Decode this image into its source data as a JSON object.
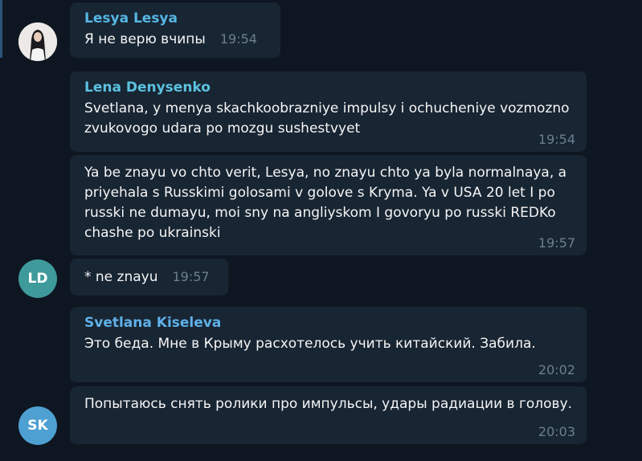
{
  "colors": {
    "background": "#0e1621",
    "bubble": "#182533",
    "name_lesya": "#56b7e4",
    "name_lena": "#5bc2e0",
    "name_svetlana": "#5fb1e8",
    "avatar_ld": "#3e9a9b",
    "avatar_sk": "#4ea0d2",
    "time": "#6d7f8f"
  },
  "messages": [
    {
      "sender": "Lesya Lesya",
      "text": "Я не верю вчипы",
      "time": "19:54"
    },
    {
      "sender": "Lena Denysenko",
      "text": "Svetlana, y menya skachkoobrazniye impulsy i ochucheniye vozmozno zvukovogo udara po mozgu sushestvyet",
      "time": "19:54"
    },
    {
      "text": "Ya be znayu vo chto verit, Lesya, no znayu chto ya byla normalnaya, a priyehala s Russkimi golosami v golove s Kryma. Ya v USA 20 let I po russki ne dumayu, moi sny na angliyskom I govoryu po russki REDKo chashe po ukrainski",
      "time": "19:57"
    },
    {
      "text": "* ne znayu",
      "time": "19:57"
    },
    {
      "sender": "Svetlana Kiseleva",
      "text": "Это беда. Мне в Крыму расхотелось учить китайский. Забила.",
      "time": "20:02"
    },
    {
      "text": "Попытаюсь снять ролики про импульсы, удары радиации в голову.",
      "time": "20:03"
    }
  ],
  "avatars": {
    "ld": "LD",
    "sk": "SK"
  }
}
